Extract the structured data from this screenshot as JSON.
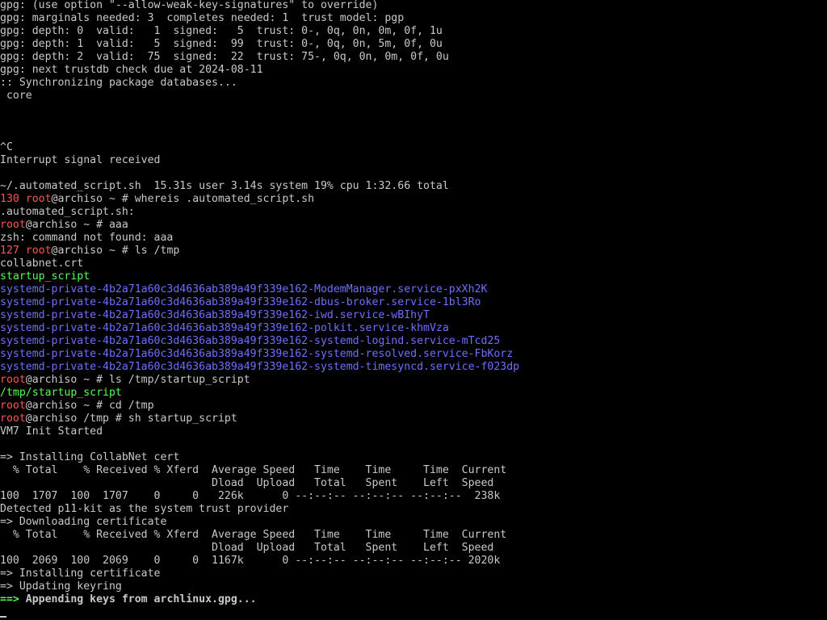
{
  "colors": {
    "background": "#000000",
    "default": "#c9c9c9",
    "red": "#ff5555",
    "green": "#55ff55",
    "blue": "#6f6fff"
  },
  "lines": [
    [
      {
        "t": "gpg: (use option \"--allow-weak-key-signatures\" to override)",
        "c": "default"
      }
    ],
    [
      {
        "t": "gpg: marginals needed: 3  completes needed: 1  trust model: pgp",
        "c": "default"
      }
    ],
    [
      {
        "t": "gpg: depth: 0  valid:   1  signed:   5  trust: 0-, 0q, 0n, 0m, 0f, 1u",
        "c": "default"
      }
    ],
    [
      {
        "t": "gpg: depth: 1  valid:   5  signed:  99  trust: 0-, 0q, 0n, 5m, 0f, 0u",
        "c": "default"
      }
    ],
    [
      {
        "t": "gpg: depth: 2  valid:  75  signed:  22  trust: 75-, 0q, 0n, 0m, 0f, 0u",
        "c": "default"
      }
    ],
    [
      {
        "t": "gpg: next trustdb check due at 2024-08-11",
        "c": "default"
      }
    ],
    [
      {
        "t": ":: Synchronizing package databases...",
        "c": "default"
      }
    ],
    [
      {
        "t": " core",
        "c": "default"
      }
    ],
    [],
    [],
    [],
    [
      {
        "t": "^C",
        "c": "default"
      }
    ],
    [
      {
        "t": "Interrupt signal received",
        "c": "default"
      }
    ],
    [],
    [
      {
        "t": "~/.automated_script.sh  15.31s user 3.14s system 19% cpu 1:32.66 total",
        "c": "default"
      }
    ],
    [
      {
        "t": "130 ",
        "c": "red"
      },
      {
        "t": "root",
        "c": "red"
      },
      {
        "t": "@archiso ~ # whereis .automated_script.sh",
        "c": "default"
      }
    ],
    [
      {
        "t": ".automated_script.sh:",
        "c": "default"
      }
    ],
    [
      {
        "t": "root",
        "c": "red"
      },
      {
        "t": "@archiso ~ # aaa",
        "c": "default"
      }
    ],
    [
      {
        "t": "zsh: command not found: aaa",
        "c": "default"
      }
    ],
    [
      {
        "t": "127 ",
        "c": "red"
      },
      {
        "t": "root",
        "c": "red"
      },
      {
        "t": "@archiso ~ # ls /tmp",
        "c": "default"
      }
    ],
    [
      {
        "t": "collabnet.crt",
        "c": "default"
      }
    ],
    [
      {
        "t": "startup_script",
        "c": "green"
      }
    ],
    [
      {
        "t": "systemd-private-4b2a71a60c3d4636ab389a49f339e162-ModemManager.service-pxXh2K",
        "c": "blue"
      }
    ],
    [
      {
        "t": "systemd-private-4b2a71a60c3d4636ab389a49f339e162-dbus-broker.service-1bl3Ro",
        "c": "blue"
      }
    ],
    [
      {
        "t": "systemd-private-4b2a71a60c3d4636ab389a49f339e162-iwd.service-wBIhyT",
        "c": "blue"
      }
    ],
    [
      {
        "t": "systemd-private-4b2a71a60c3d4636ab389a49f339e162-polkit.service-khmVza",
        "c": "blue"
      }
    ],
    [
      {
        "t": "systemd-private-4b2a71a60c3d4636ab389a49f339e162-systemd-logind.service-mTcd25",
        "c": "blue"
      }
    ],
    [
      {
        "t": "systemd-private-4b2a71a60c3d4636ab389a49f339e162-systemd-resolved.service-FbKorz",
        "c": "blue"
      }
    ],
    [
      {
        "t": "systemd-private-4b2a71a60c3d4636ab389a49f339e162-systemd-timesyncd.service-f023dp",
        "c": "blue"
      }
    ],
    [
      {
        "t": "root",
        "c": "red"
      },
      {
        "t": "@archiso ~ # ls /tmp/startup_script",
        "c": "default"
      }
    ],
    [
      {
        "t": "/tmp/startup_script",
        "c": "green"
      }
    ],
    [
      {
        "t": "root",
        "c": "red"
      },
      {
        "t": "@archiso ~ # cd /tmp",
        "c": "default"
      }
    ],
    [
      {
        "t": "root",
        "c": "red"
      },
      {
        "t": "@archiso /tmp # sh startup_script",
        "c": "default"
      }
    ],
    [
      {
        "t": "VM7 Init Started",
        "c": "default"
      }
    ],
    [],
    [
      {
        "t": "=> Installing CollabNet cert",
        "c": "default"
      }
    ],
    [
      {
        "t": "  % Total    % Received % Xferd  Average Speed   Time    Time     Time  Current",
        "c": "default"
      }
    ],
    [
      {
        "t": "                                 Dload  Upload   Total   Spent    Left  Speed",
        "c": "default"
      }
    ],
    [
      {
        "t": "100  1707  100  1707    0     0   226k      0 --:--:-- --:--:-- --:--:--  238k",
        "c": "default"
      }
    ],
    [
      {
        "t": "Detected p11-kit as the system trust provider",
        "c": "default"
      }
    ],
    [
      {
        "t": "=> Downloading certificate",
        "c": "default"
      }
    ],
    [
      {
        "t": "  % Total    % Received % Xferd  Average Speed   Time    Time     Time  Current",
        "c": "default"
      }
    ],
    [
      {
        "t": "                                 Dload  Upload   Total   Spent    Left  Speed",
        "c": "default"
      }
    ],
    [
      {
        "t": "100  2069  100  2069    0     0  1167k      0 --:--:-- --:--:-- --:--:-- 2020k",
        "c": "default"
      }
    ],
    [
      {
        "t": "=> Installing certificate",
        "c": "default"
      }
    ],
    [
      {
        "t": "=> Updating keyring",
        "c": "default"
      }
    ],
    [
      {
        "t": "==>",
        "c": "green",
        "b": true
      },
      {
        "t": " Appending keys from archlinux.gpg...",
        "c": "default",
        "b": true
      }
    ]
  ]
}
